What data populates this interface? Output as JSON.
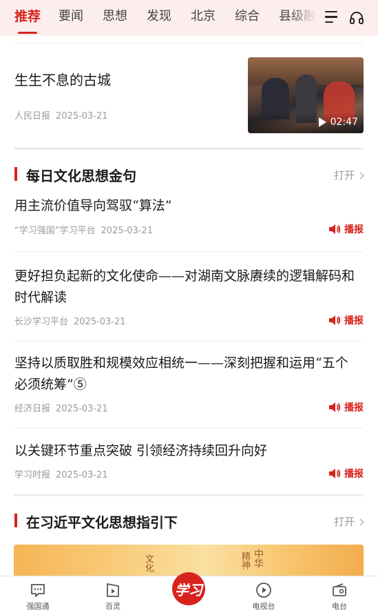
{
  "tabs": [
    "推荐",
    "要闻",
    "思想",
    "发现",
    "北京",
    "综合",
    "县级融"
  ],
  "featured": {
    "title": "生生不息的古城",
    "source": "人民日报",
    "date": "2025-03-21",
    "duration": "02:47"
  },
  "section1": {
    "title": "每日文化思想金句",
    "open_label": "打开"
  },
  "articles": [
    {
      "title": "用主流价值导向驾驭“算法”",
      "source": "“学习强国”学习平台",
      "date": "2025-03-21",
      "play_label": "播报"
    },
    {
      "title": "更好担负起新的文化使命——对湖南文脉赓续的逻辑解码和时代解读",
      "source": "长沙学习平台",
      "date": "2025-03-21",
      "play_label": "播报"
    },
    {
      "title": "坚持以质取胜和规模效应相统一——深刻把握和运用“五个必须统筹”⑤",
      "source": "经济日报",
      "date": "2025-03-21",
      "play_label": "播报"
    },
    {
      "title": "以关键环节重点突破 引领经济持续回升向好",
      "source": "学习时报",
      "date": "2025-03-21",
      "play_label": "播报"
    }
  ],
  "section2": {
    "title": "在习近平文化思想指引下",
    "open_label": "打开"
  },
  "banner_text": [
    "文化",
    "中华",
    "精神"
  ],
  "bottom_nav": [
    {
      "label": "强国通",
      "icon": "chat-icon"
    },
    {
      "label": "百灵",
      "icon": "video-icon"
    },
    {
      "label": "学习",
      "icon": "xuexi-logo"
    },
    {
      "label": "电视台",
      "icon": "play-circle-icon"
    },
    {
      "label": "电台",
      "icon": "radio-icon"
    }
  ],
  "colors": {
    "accent": "#d8231c",
    "tabbar_bg": "#fdeeee"
  }
}
